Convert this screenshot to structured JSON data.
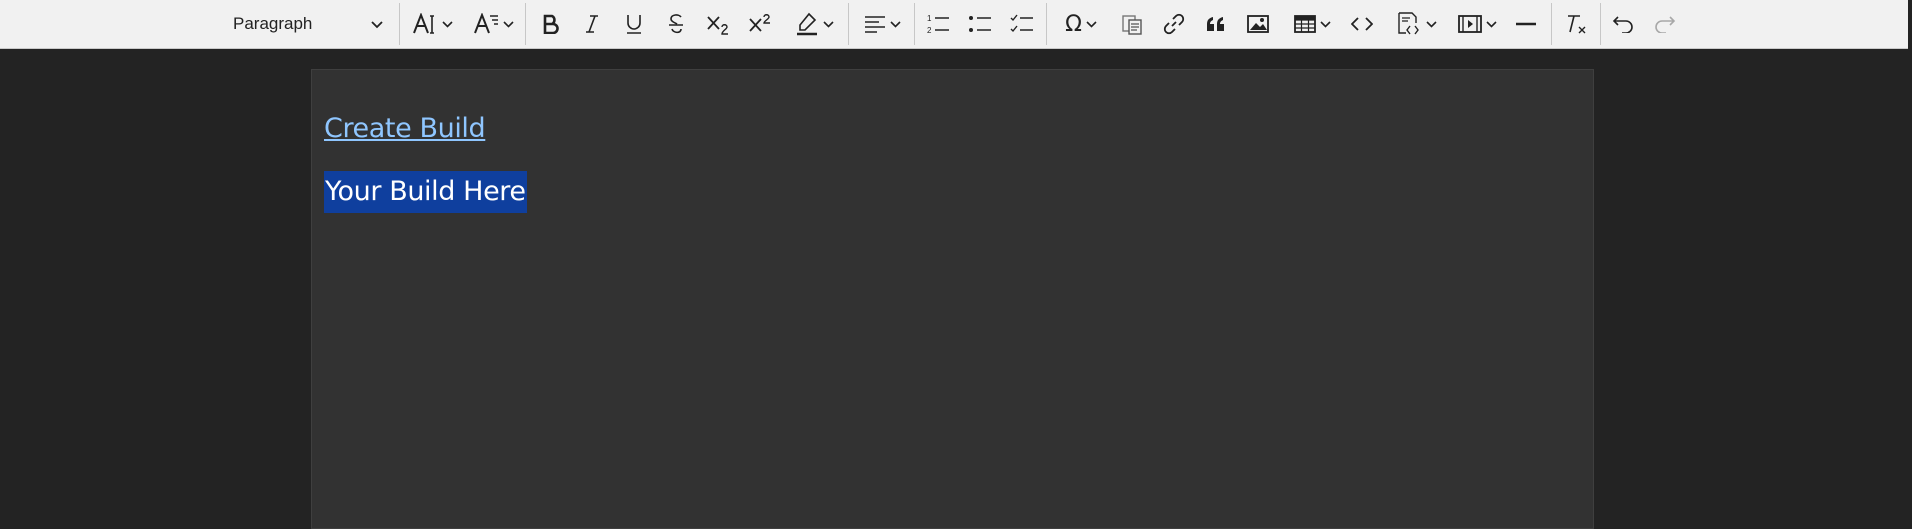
{
  "toolbar": {
    "heading_select": {
      "value": "Paragraph"
    },
    "buttons": [
      {
        "name": "font-size-button",
        "icon": "font-size-icon",
        "has_dropdown": true
      },
      {
        "name": "font-family-button",
        "icon": "font-family-icon",
        "has_dropdown": true
      },
      {
        "name": "bold-button",
        "icon": "bold-icon"
      },
      {
        "name": "italic-button",
        "icon": "italic-icon"
      },
      {
        "name": "underline-button",
        "icon": "underline-icon"
      },
      {
        "name": "strikethrough-button",
        "icon": "strikethrough-icon"
      },
      {
        "name": "subscript-button",
        "icon": "subscript-icon"
      },
      {
        "name": "superscript-button",
        "icon": "superscript-icon"
      },
      {
        "name": "highlight-button",
        "icon": "highlighter-icon",
        "has_dropdown": true
      },
      {
        "name": "align-button",
        "icon": "align-left-icon",
        "has_dropdown": true
      },
      {
        "name": "numbered-list-button",
        "icon": "numbered-list-icon"
      },
      {
        "name": "bulleted-list-button",
        "icon": "bulleted-list-icon"
      },
      {
        "name": "todo-list-button",
        "icon": "todo-list-icon"
      },
      {
        "name": "special-characters-button",
        "icon": "omega-icon",
        "has_dropdown": true
      },
      {
        "name": "paste-plain-text-button",
        "icon": "paste-icon"
      },
      {
        "name": "link-button",
        "icon": "link-icon"
      },
      {
        "name": "block-quote-button",
        "icon": "quote-icon"
      },
      {
        "name": "insert-image-button",
        "icon": "image-icon"
      },
      {
        "name": "insert-table-button",
        "icon": "table-icon",
        "has_dropdown": true
      },
      {
        "name": "code-button",
        "icon": "code-icon"
      },
      {
        "name": "code-block-button",
        "icon": "code-block-icon",
        "has_dropdown": true
      },
      {
        "name": "insert-media-button",
        "icon": "media-icon",
        "has_dropdown": true
      },
      {
        "name": "horizontal-line-button",
        "icon": "horizontal-line-icon"
      },
      {
        "name": "remove-format-button",
        "icon": "remove-format-icon"
      },
      {
        "name": "undo-button",
        "icon": "undo-icon"
      },
      {
        "name": "redo-button",
        "icon": "redo-icon",
        "disabled": true
      }
    ]
  },
  "editor": {
    "link_text": "Create Build",
    "selected_text": "Your Build Here"
  },
  "colors": {
    "toolbar_bg": "#f1f1f1",
    "page_bg": "#232323",
    "editor_bg": "#323232",
    "link": "#8fc6ff",
    "selection": "#0f3f9e"
  }
}
